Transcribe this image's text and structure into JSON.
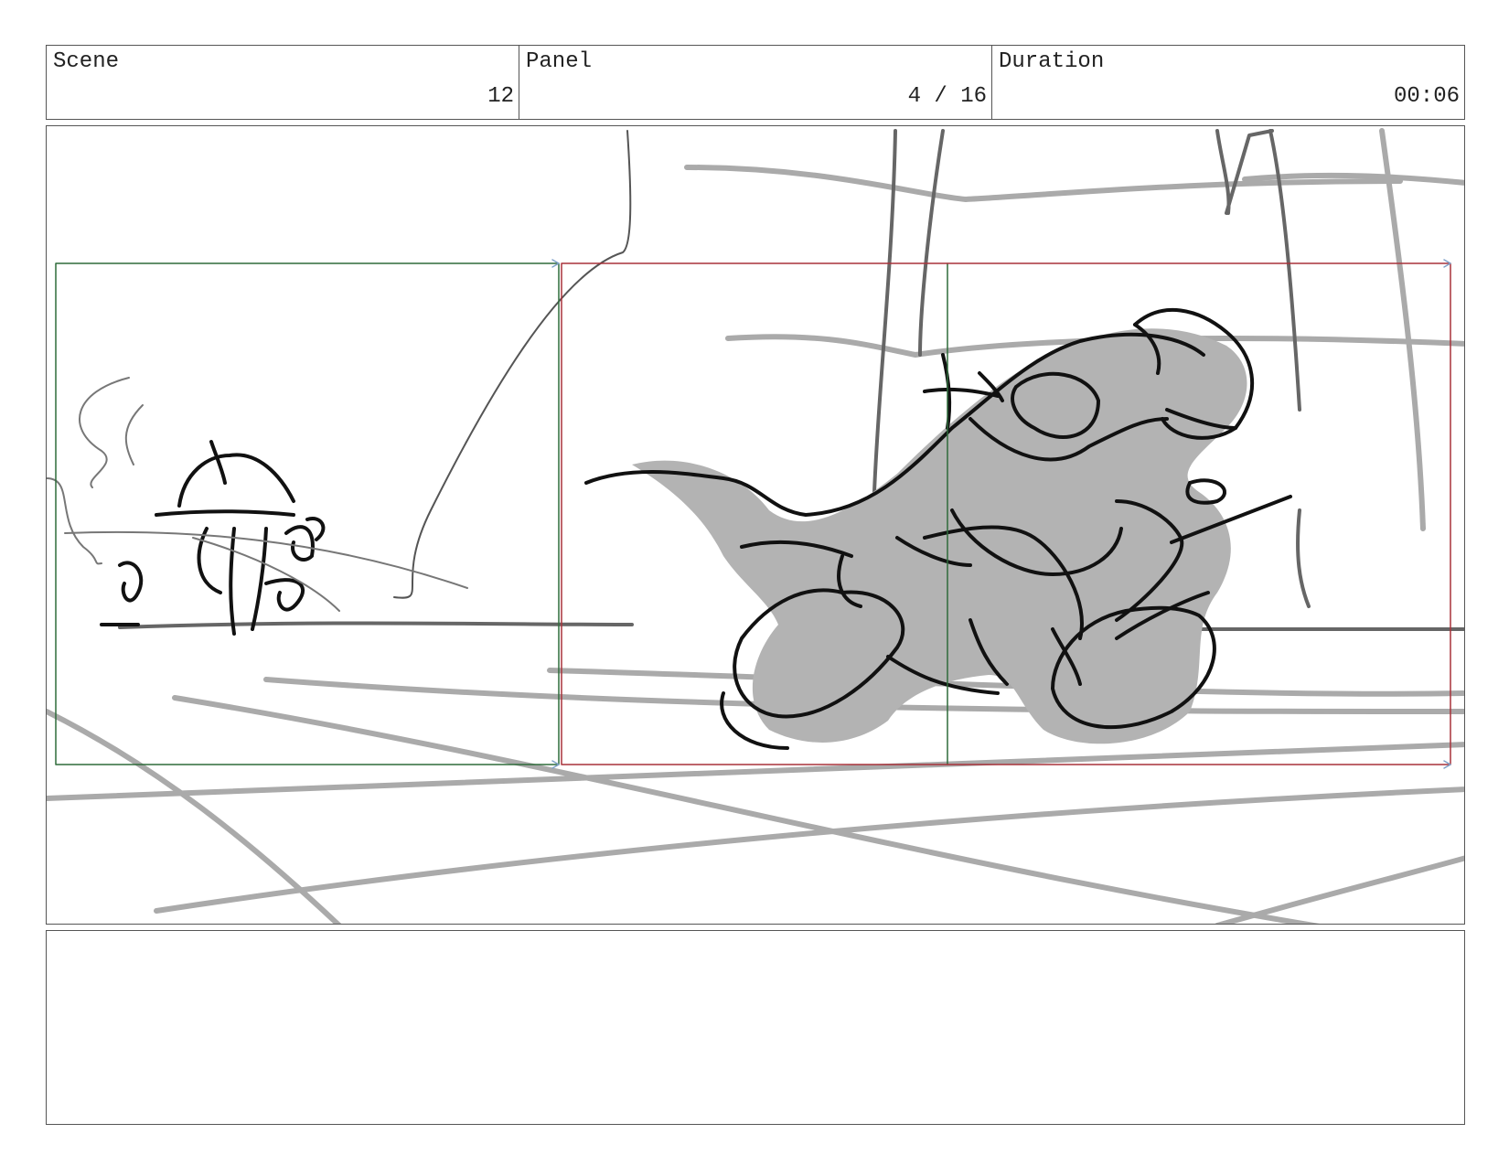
{
  "header": {
    "scene": {
      "label": "Scene",
      "value": "12"
    },
    "panel": {
      "label": "Panel",
      "value": "4 / 16"
    },
    "duration": {
      "label": "Duration",
      "value": "00:06"
    }
  },
  "camera_frames": {
    "start_frame_color": "#2e6b3a",
    "end_frame_color": "#a8323a",
    "guide_arrow_color": "#7fa0c8"
  },
  "sketch_colors": {
    "ink": "#111111",
    "fill": "#b3b3b3",
    "background_lines": "#aaaaaa",
    "dark_lines": "#666666"
  },
  "notes": {
    "text": ""
  }
}
